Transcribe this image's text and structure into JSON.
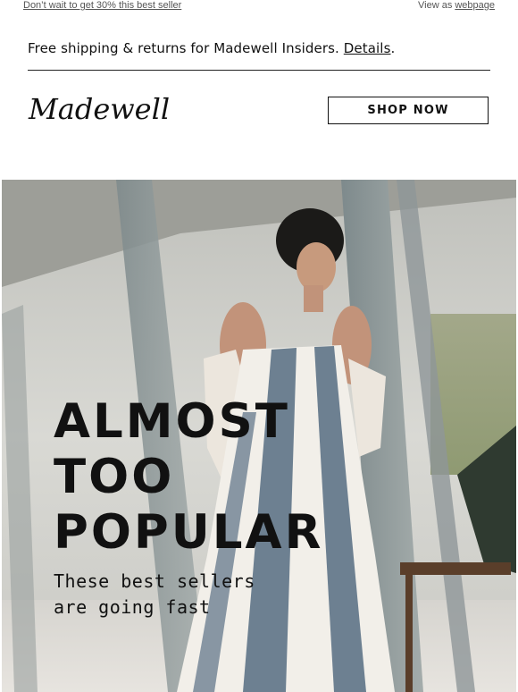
{
  "preheader": {
    "left_link": "Don’t wait to get 30% this best seller",
    "right_text": "View as",
    "right_link": "webpage"
  },
  "shipping_bar": {
    "text": "Free shipping & returns for Madewell Insiders.",
    "link": "Details",
    "suffix": "."
  },
  "header": {
    "logo_text": "Madewell",
    "cta_label": "SHOP NOW"
  },
  "hero": {
    "headline_lines": [
      "ALMOST",
      "TOO",
      "POPULAR"
    ],
    "subhead_lines": [
      "These best sellers",
      "are going fast"
    ]
  }
}
